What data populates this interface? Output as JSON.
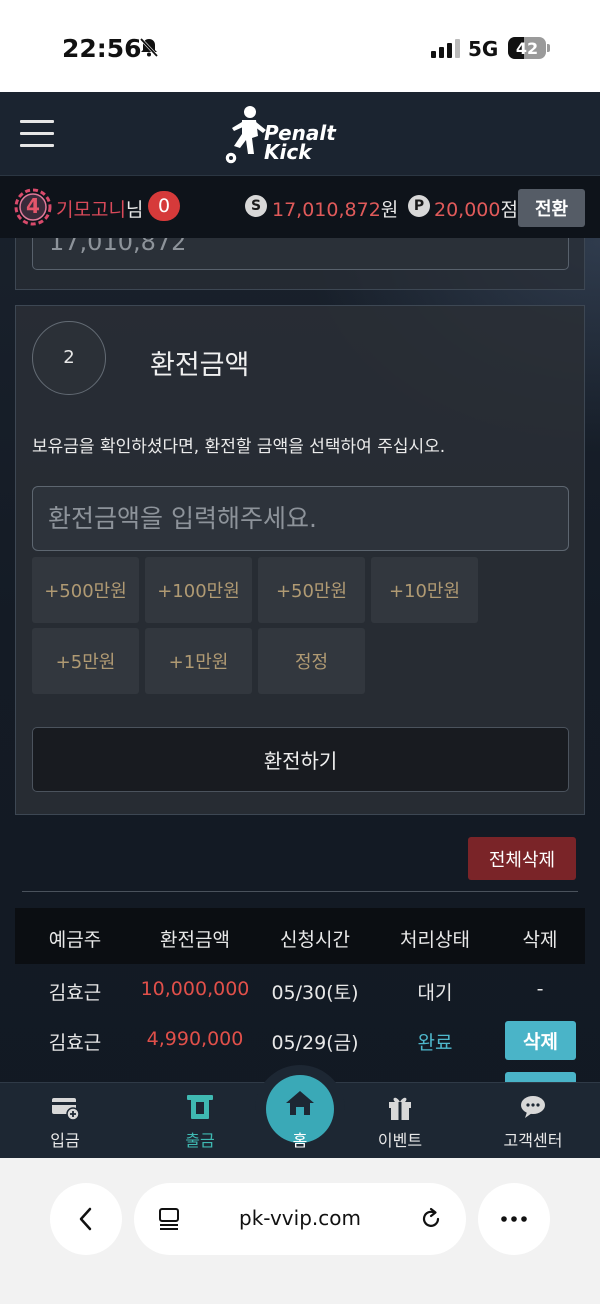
{
  "status_bar": {
    "time": "22:56",
    "network": "5G",
    "battery": "42",
    "battery_level": 0.42
  },
  "header": {
    "logo_text_line1": "Penalt",
    "logo_text_line2": "Kick"
  },
  "user_bar": {
    "level": "4",
    "username": "기모고니",
    "honorific": "님",
    "message_count": "0",
    "money_icon": "S",
    "money_amount": "17,010,872",
    "money_unit": "원",
    "point_icon": "P",
    "points_amount": "20,000",
    "points_unit": "점",
    "switch_label": "전환"
  },
  "balance_panel": {
    "value": "17,010,872"
  },
  "exchange_panel": {
    "step": "2",
    "title": "환전금액",
    "description": "보유금을 확인하셨다면, 환전할 금액을 선택하여 주십시오.",
    "amount_placeholder": "환전금액을 입력해주세요.",
    "amount_buttons": [
      "+500만원",
      "+100만원",
      "+50만원",
      "+10만원",
      "+5만원",
      "+1만원",
      "정정"
    ],
    "submit_label": "환전하기"
  },
  "history": {
    "delete_all_label": "전체삭제",
    "columns": [
      "예금주",
      "환전금액",
      "신청시간",
      "처리상태",
      "삭제"
    ],
    "rows": [
      {
        "depositor": "김효근",
        "amount": "10,000,000",
        "time": "05/30(토)",
        "status": "대기",
        "action": "-"
      },
      {
        "depositor": "김효근",
        "amount": "4,990,000",
        "time": "05/29(금)",
        "status": "완료",
        "action": "삭제"
      }
    ]
  },
  "bottom_nav": {
    "items": [
      {
        "label": "입금",
        "icon": "deposit-card-icon"
      },
      {
        "label": "출금",
        "icon": "withdraw-atm-icon"
      },
      {
        "label": "홈",
        "icon": "home-icon"
      },
      {
        "label": "이벤트",
        "icon": "gift-icon"
      },
      {
        "label": "고객센터",
        "icon": "chat-icon"
      }
    ]
  },
  "browser": {
    "url": "pk-vvip.com"
  },
  "colors": {
    "accent_teal": "#3aa9b7",
    "money_red": "#e05a5a",
    "delete_all_red": "#7a2428",
    "amount_button_text": "#b09a73"
  }
}
